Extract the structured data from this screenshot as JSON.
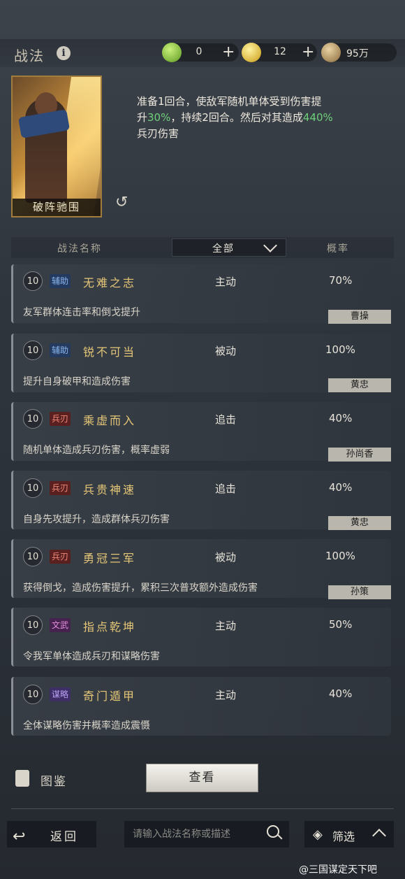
{
  "header": {
    "title": "战法",
    "info_icon": "i"
  },
  "resources": [
    {
      "icon": "jade-coin-icon",
      "value": "0",
      "color": "#7fbf3a"
    },
    {
      "icon": "gold-coin-icon",
      "value": "12",
      "color": "#e8c030"
    },
    {
      "icon": "copper-coin-icon",
      "value": "95万",
      "color": "#a88a5a"
    }
  ],
  "selected": {
    "card_name": "破阵驰围",
    "desc_1": "准备1回合，使敌军随机单体受到伤害提",
    "desc_2a": "升",
    "desc_2b": "30%",
    "desc_2c": "，持续2回合。然后对其造成",
    "desc_2d": "440%",
    "desc_3": "兵刃伤害"
  },
  "table_header": {
    "name": "战法名称",
    "filter": "全部",
    "rate": "概率"
  },
  "rows": [
    {
      "level": "10",
      "tag": "辅助",
      "name": "无难之志",
      "type": "主动",
      "rate": "70%",
      "desc": "友军群体连击率和倒戈提升",
      "general": "曹操"
    },
    {
      "level": "10",
      "tag": "辅助",
      "name": "锐不可当",
      "type": "被动",
      "rate": "100%",
      "desc": "提升自身破甲和造成伤害",
      "general": "黄忠"
    },
    {
      "level": "10",
      "tag": "兵刃",
      "name": "乘虚而入",
      "type": "追击",
      "rate": "40%",
      "desc": "随机单体造成兵刃伤害，概率虚弱",
      "general": "孙尚香"
    },
    {
      "level": "10",
      "tag": "兵刃",
      "name": "兵贵神速",
      "type": "追击",
      "rate": "40%",
      "desc": "自身先攻提升，造成群体兵刃伤害",
      "general": "黄忠"
    },
    {
      "level": "10",
      "tag": "兵刃",
      "name": "勇冠三军",
      "type": "被动",
      "rate": "100%",
      "desc": "获得倒戈，造成伤害提升，累积三次普攻额外造成伤害",
      "general": "孙策"
    },
    {
      "level": "10",
      "tag": "文武",
      "name": "指点乾坤",
      "type": "主动",
      "rate": "50%",
      "desc": "令我军单体造成兵刃和谋略伤害",
      "general": ""
    },
    {
      "level": "10",
      "tag": "谋略",
      "name": "奇门遁甲",
      "type": "主动",
      "rate": "40%",
      "desc": "全体谋略伤害并概率造成震慑",
      "general": ""
    }
  ],
  "bottom": {
    "atlas": "图鉴",
    "view": "查看",
    "back": "返回",
    "search_placeholder": "请输入战法名称或描述",
    "filter": "筛选"
  },
  "watermark": "@三国谋定天下吧"
}
